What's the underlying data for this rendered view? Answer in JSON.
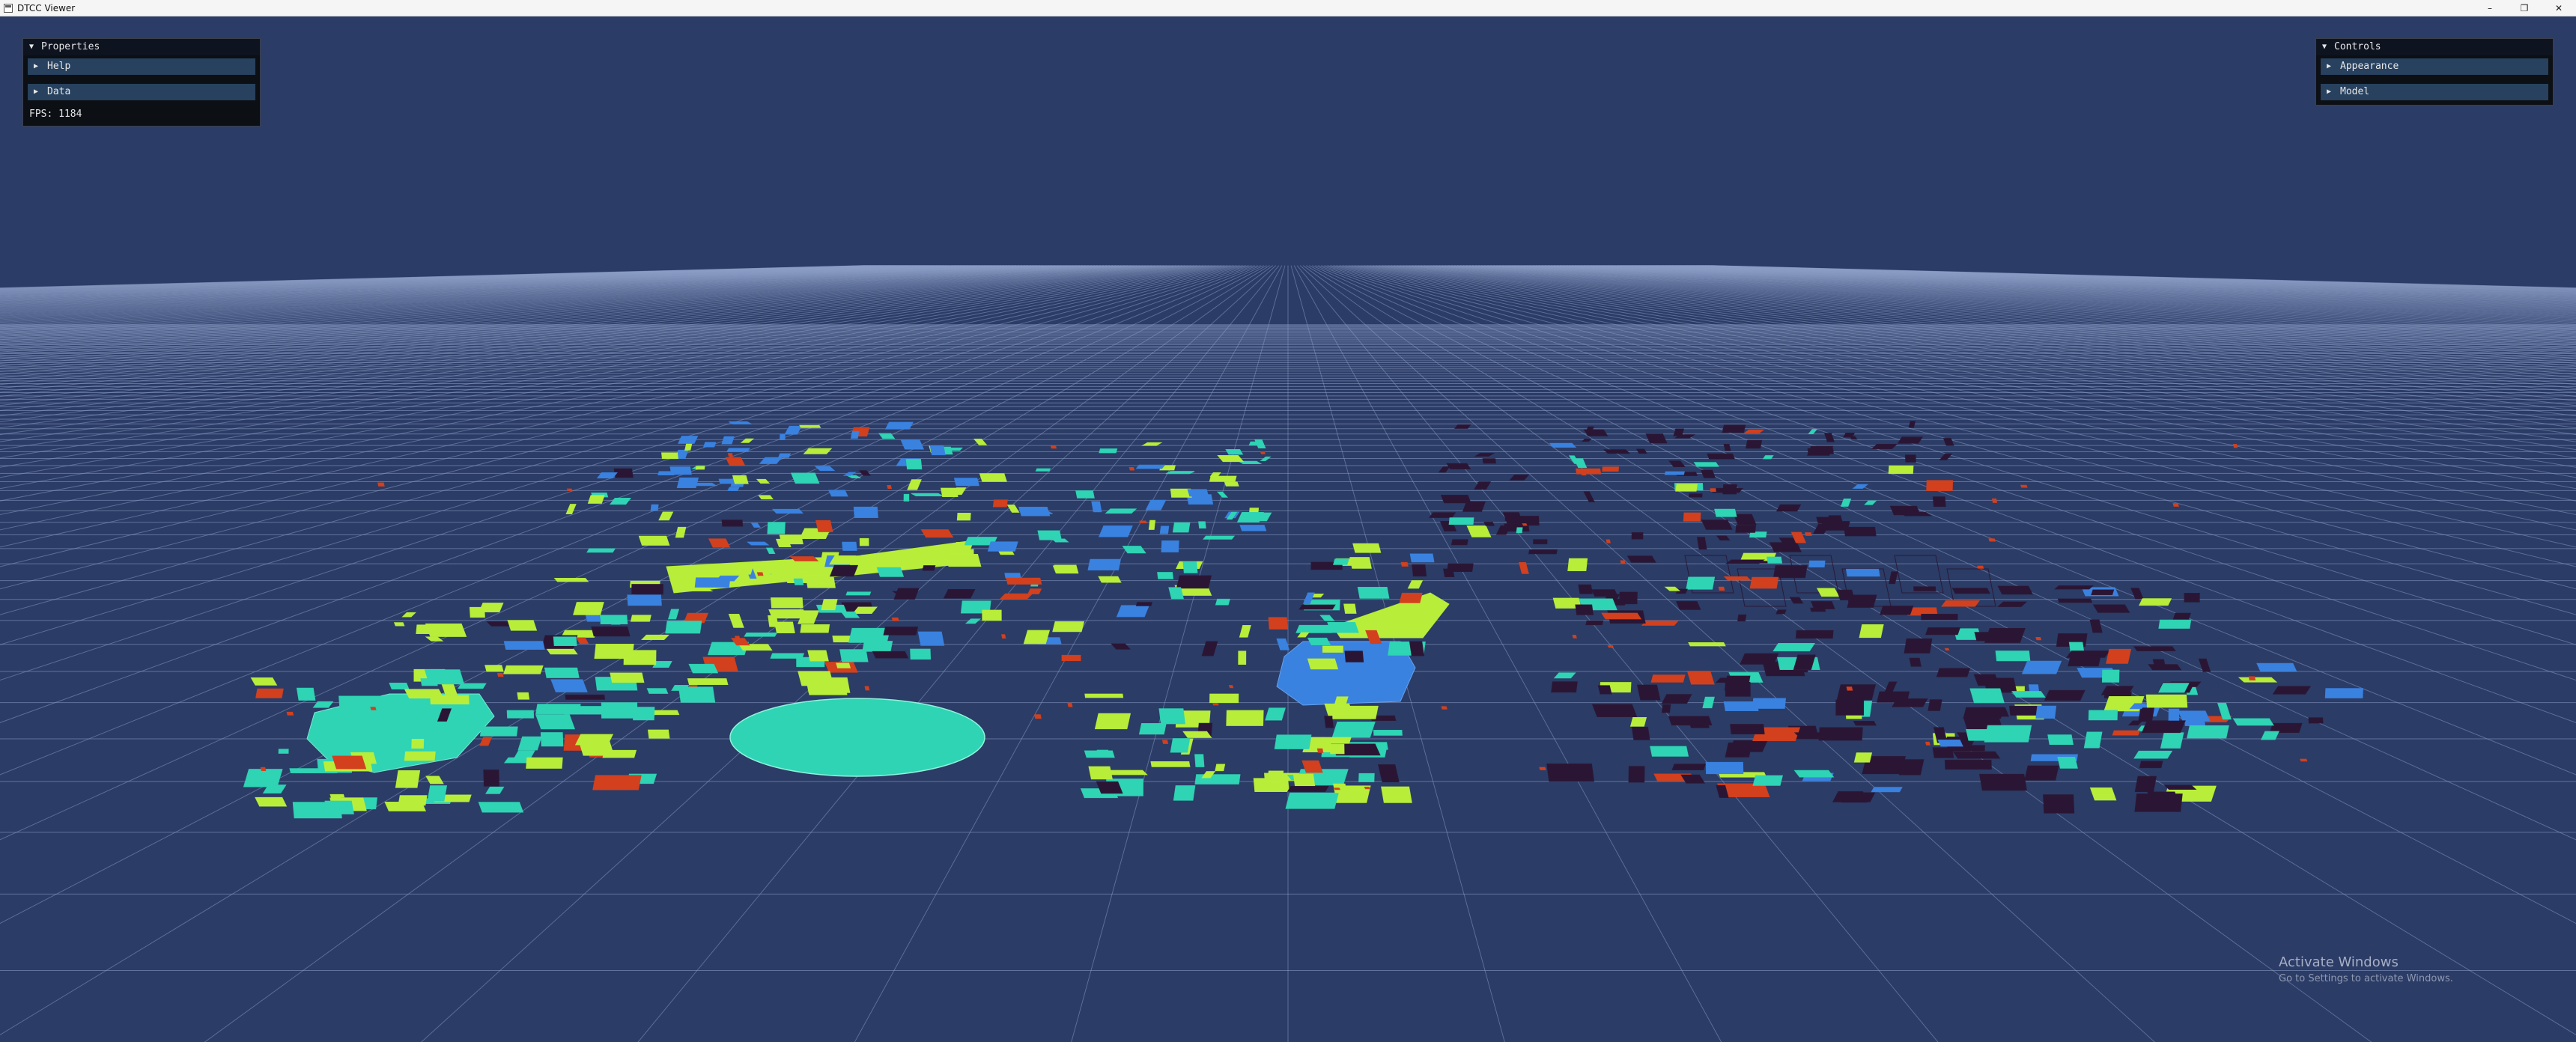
{
  "window": {
    "title": "DTCC Viewer",
    "minimize_glyph": "–",
    "maximize_glyph": "❐",
    "close_glyph": "✕"
  },
  "properties_panel": {
    "title": "Properties",
    "sections": [
      "Help",
      "Data"
    ],
    "fps_label": "FPS: 1184"
  },
  "controls_panel": {
    "title": "Controls",
    "sections": [
      "Appearance",
      "Model"
    ]
  },
  "watermark": {
    "title": "Activate Windows",
    "subtitle": "Go to Settings to activate Windows."
  },
  "icons": {
    "expanded": "triangle-down-icon",
    "collapsed": "triangle-right-icon"
  },
  "colors": {
    "background": "#2b3c66",
    "grid": "#8ea0c8",
    "lime": "#b8ee3a",
    "teal": "#2fd4b4",
    "blue": "#3a82e0",
    "dark": "#2a1634",
    "red": "#d2401e"
  }
}
